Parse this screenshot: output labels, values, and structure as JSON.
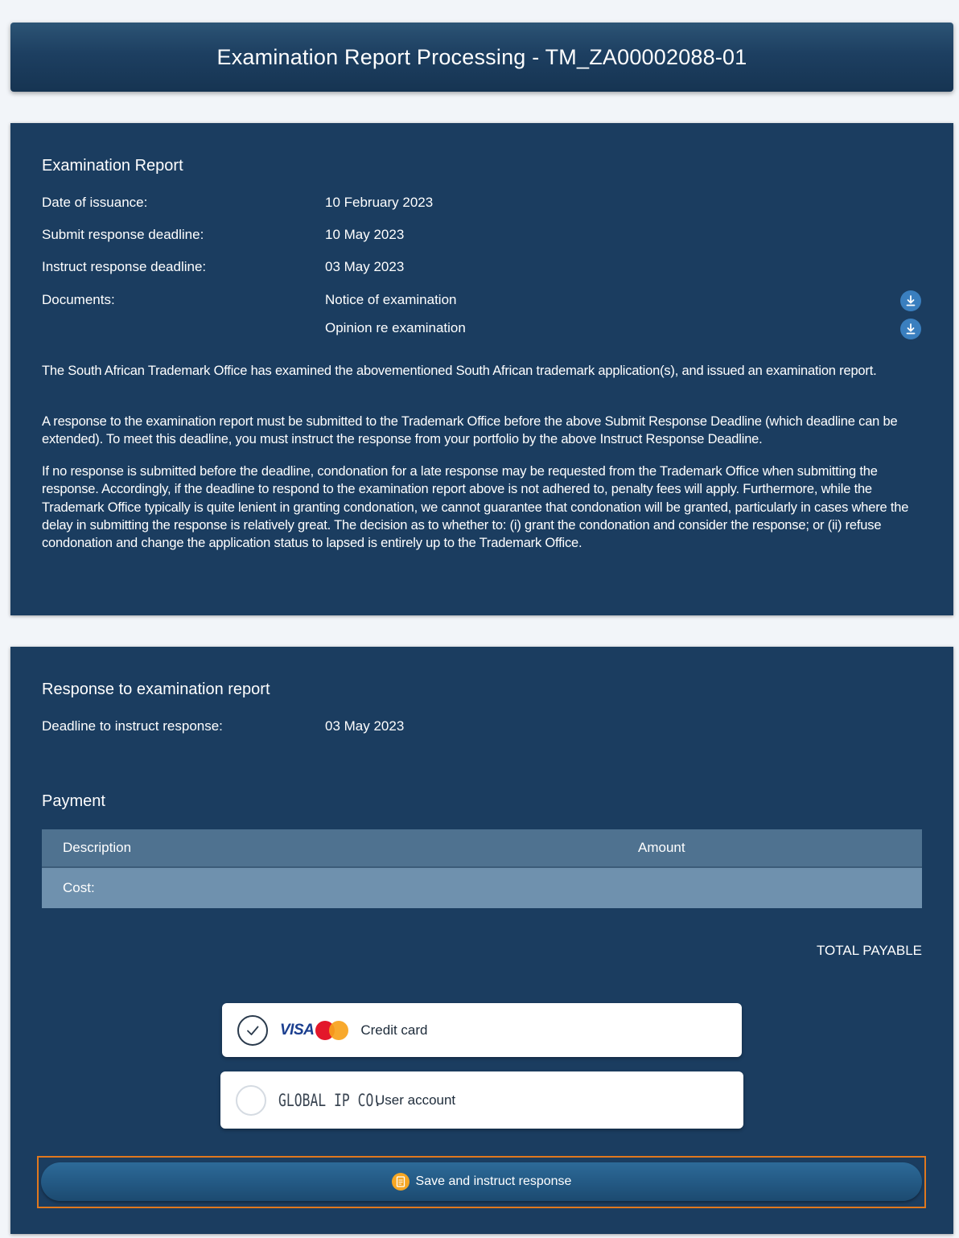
{
  "header": {
    "title": "Examination Report Processing - TM_ZA00002088-01"
  },
  "exam_report": {
    "title": "Examination Report",
    "fields": [
      {
        "label": "Date of issuance:",
        "value": "10 February 2023"
      },
      {
        "label": "Submit response deadline:",
        "value": "10 May 2023"
      },
      {
        "label": "Instruct response deadline:",
        "value": "03 May 2023"
      }
    ],
    "documents_label": "Documents:",
    "documents": [
      "Notice of examination",
      "Opinion re examination"
    ],
    "paragraphs": [
      "The South African Trademark Office has examined the abovementioned South African trademark application(s), and issued an examination report.",
      "A response to the examination report must be submitted to the Trademark Office before the above Submit Response Deadline (which deadline can be extended). To meet this deadline, you must instruct the response from your portfolio by the above Instruct Response Deadline.",
      "If no response is submitted before the deadline, condonation for a late response may be requested from the Trademark Office when submitting the response. Accordingly, if the deadline to respond to the examination report above is not adhered to, penalty fees will apply. Furthermore, while the Trademark Office typically is quite lenient in granting condonation, we cannot guarantee that condonation will be granted, particularly in cases where the delay in submitting the response is relatively great. The decision as to whether to: (i) grant the condonation and consider the response; or (ii) refuse condonation and change the application status to lapsed is entirely up to the Trademark Office."
    ]
  },
  "response": {
    "title": "Response to examination report",
    "deadline_label": "Deadline to instruct response:",
    "deadline_value": "03 May 2023"
  },
  "payment": {
    "title": "Payment",
    "columns": [
      "Description",
      "Amount"
    ],
    "rows": [
      {
        "description": "Cost:",
        "amount": ""
      }
    ],
    "total_label": "TOTAL PAYABLE",
    "options": [
      {
        "brand_text": "VISA",
        "label": "Credit card",
        "selected": true
      },
      {
        "brand_text": "GLOBAL IP CO.",
        "label": "User account",
        "selected": false
      }
    ]
  },
  "actions": {
    "save_label": "Save and instruct response"
  },
  "colors": {
    "panel": "#1b3d60",
    "header": "#1d3f61",
    "table_head": "#4f7290",
    "table_row": "#6f91ae",
    "accent_orange": "#e0781e",
    "icon_blue": "#3a7fbf"
  }
}
